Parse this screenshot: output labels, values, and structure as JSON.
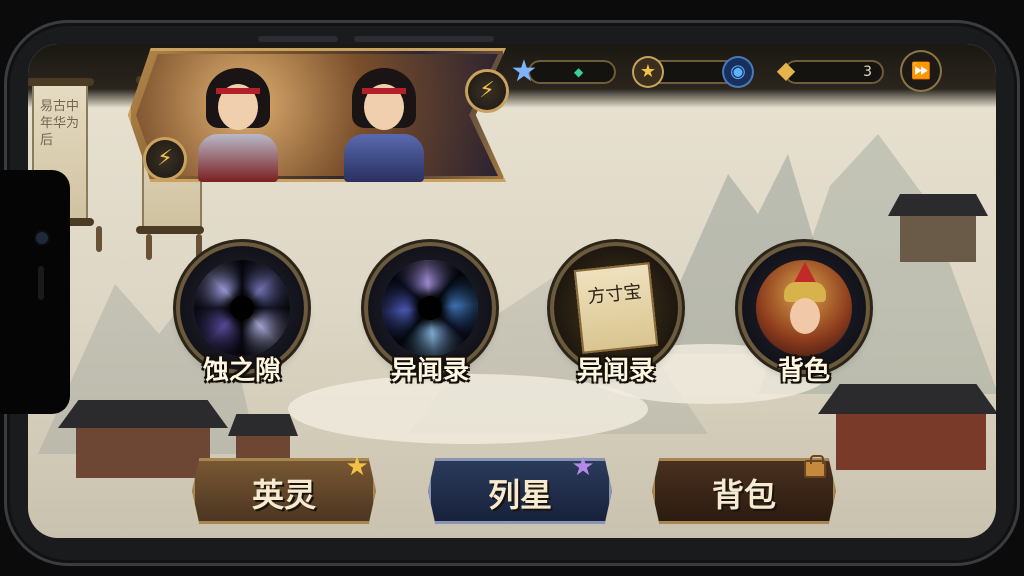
{
  "resources": {
    "star_value": "",
    "gold_value": "",
    "gem_value": "3"
  },
  "left_scroll": {
    "text": "易古中年华为后"
  },
  "nodes": [
    {
      "label": "蚀之隙",
      "kind": "vortex-purple"
    },
    {
      "label": "异闻录",
      "kind": "vortex-blue"
    },
    {
      "label": "异闻录",
      "kind": "scroll",
      "scroll_text": "方寸宝"
    },
    {
      "label": "背色",
      "kind": "hero-portrait"
    }
  ],
  "tabs": [
    {
      "label": "英灵",
      "badge": "star-gold-icon"
    },
    {
      "label": "列星",
      "badge": "star-purple-icon"
    },
    {
      "label": "背包",
      "badge": "bag-icon"
    }
  ],
  "icons": {
    "bolt": "⚡",
    "star_blue": "★",
    "star_gold": "★",
    "orb_blue": "◉",
    "gem_gold": "◆",
    "skip": "⏩",
    "diamond_green": "◆"
  },
  "colors": {
    "gold_trim": "#c8a25e",
    "tab_brown": "#5a3e22",
    "tab_blue": "#1f2c44",
    "tab_dark": "#3a2618"
  }
}
